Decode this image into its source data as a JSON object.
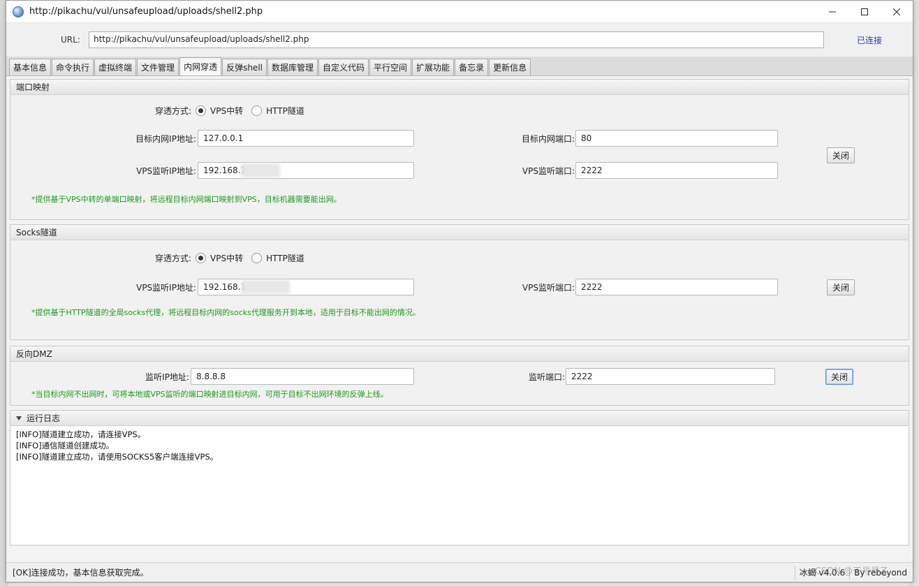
{
  "window": {
    "title": "http://pikachu/vul/unsafeupload/uploads/shell2.php",
    "minimize_label": "—",
    "maximize_label": "☐",
    "close_label": "✕"
  },
  "urlbar": {
    "label": "URL:",
    "value": "http://pikachu/vul/unsafeupload/uploads/shell2.php",
    "status": "已连接"
  },
  "tabs": [
    {
      "label": "基本信息"
    },
    {
      "label": "命令执行"
    },
    {
      "label": "虚拟终端"
    },
    {
      "label": "文件管理"
    },
    {
      "label": "内网穿透",
      "active": true
    },
    {
      "label": "反弹shell"
    },
    {
      "label": "数据库管理"
    },
    {
      "label": "自定义代码"
    },
    {
      "label": "平行空间"
    },
    {
      "label": "扩展功能"
    },
    {
      "label": "备忘录"
    },
    {
      "label": "更新信息"
    }
  ],
  "port_mapping": {
    "title": "端口映射",
    "mode_label": "穿透方式:",
    "mode_vps": "VPS中转",
    "mode_http": "HTTP隧道",
    "target_ip_label": "目标内网IP地址:",
    "target_ip": "127.0.0.1",
    "target_port_label": "目标内网端口:",
    "target_port": "80",
    "vps_ip_label": "VPS监听IP地址:",
    "vps_ip": "192.168.1",
    "vps_port_label": "VPS监听端口:",
    "vps_port": "2222",
    "close_button": "关闭",
    "note": "*提供基于VPS中转的单端口映射，将远程目标内网端口映射到VPS，目标机器需要能出网。"
  },
  "socks": {
    "title": "Socks隧道",
    "mode_label": "穿透方式:",
    "mode_vps": "VPS中转",
    "mode_http": "HTTP隧道",
    "vps_ip_label": "VPS监听IP地址:",
    "vps_ip": "192.168.1",
    "vps_port_label": "VPS监听端口:",
    "vps_port": "2222",
    "close_button": "关闭",
    "note": "*提供基于HTTP隧道的全局socks代理，将远程目标内网的socks代理服务开到本地，适用于目标不能出网的情况。"
  },
  "dmz": {
    "title": "反向DMZ",
    "listen_ip_label": "监听IP地址:",
    "listen_ip": "8.8.8.8",
    "listen_port_label": "监听端口:",
    "listen_port": "2222",
    "close_button": "关闭",
    "note": "*当目标内网不出网时，可将本地或VPS监听的端口映射进目标内网，可用于目标不出网环境的反弹上线。"
  },
  "log": {
    "title": "运行日志",
    "lines": [
      "[INFO]隧道建立成功，请连接VPS。",
      "[INFO]通信隧道创建成功。",
      "[INFO]隧道建立成功，请使用SOCKS5客户端连接VPS。"
    ]
  },
  "statusbar": {
    "message": "[OK]连接成功，基本信息获取完成。",
    "version": "冰蝎 v4.0.6",
    "author": "By rebeyond"
  },
  "watermark": "CSDN @于号号乙"
}
